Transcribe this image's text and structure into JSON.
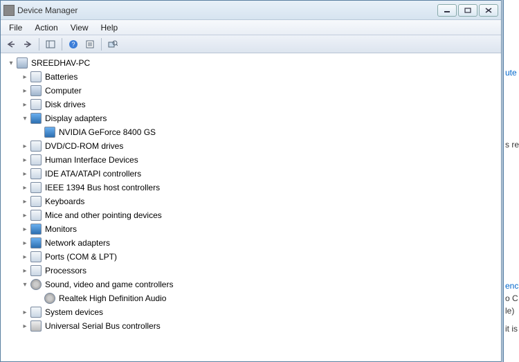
{
  "titlebar": {
    "title": "Device Manager"
  },
  "menu": {
    "file": "File",
    "action": "Action",
    "view": "View",
    "help": "Help"
  },
  "tree": {
    "root": {
      "label": "SREEDHAV-PC",
      "expanded": true
    },
    "nodes": [
      {
        "label": "Batteries",
        "icon": "battery",
        "expanded": false,
        "children": []
      },
      {
        "label": "Computer",
        "icon": "computer",
        "expanded": false,
        "children": []
      },
      {
        "label": "Disk drives",
        "icon": "disk",
        "expanded": false,
        "children": []
      },
      {
        "label": "Display adapters",
        "icon": "display",
        "expanded": true,
        "children": [
          {
            "label": "NVIDIA GeForce 8400 GS",
            "icon": "display"
          }
        ]
      },
      {
        "label": "DVD/CD-ROM drives",
        "icon": "dvd",
        "expanded": false,
        "children": []
      },
      {
        "label": "Human Interface Devices",
        "icon": "hid",
        "expanded": false,
        "children": []
      },
      {
        "label": "IDE ATA/ATAPI controllers",
        "icon": "ide",
        "expanded": false,
        "children": []
      },
      {
        "label": "IEEE 1394 Bus host controllers",
        "icon": "ieee",
        "expanded": false,
        "children": []
      },
      {
        "label": "Keyboards",
        "icon": "keyboard",
        "expanded": false,
        "children": []
      },
      {
        "label": "Mice and other pointing devices",
        "icon": "mouse",
        "expanded": false,
        "children": []
      },
      {
        "label": "Monitors",
        "icon": "monitor",
        "expanded": false,
        "children": []
      },
      {
        "label": "Network adapters",
        "icon": "network",
        "expanded": false,
        "children": []
      },
      {
        "label": "Ports (COM & LPT)",
        "icon": "port",
        "expanded": false,
        "children": []
      },
      {
        "label": "Processors",
        "icon": "cpu",
        "expanded": false,
        "children": []
      },
      {
        "label": "Sound, video and game controllers",
        "icon": "audio",
        "expanded": true,
        "children": [
          {
            "label": "Realtek High Definition Audio",
            "icon": "audio"
          }
        ]
      },
      {
        "label": "System devices",
        "icon": "system",
        "expanded": false,
        "children": []
      },
      {
        "label": "Universal Serial Bus controllers",
        "icon": "usb",
        "expanded": false,
        "children": []
      }
    ]
  },
  "rightstrip": {
    "t1": "ute",
    "t2": "s re",
    "t3": "enc",
    "t4": "o C",
    "t5": "le)",
    "t6": "it is"
  }
}
